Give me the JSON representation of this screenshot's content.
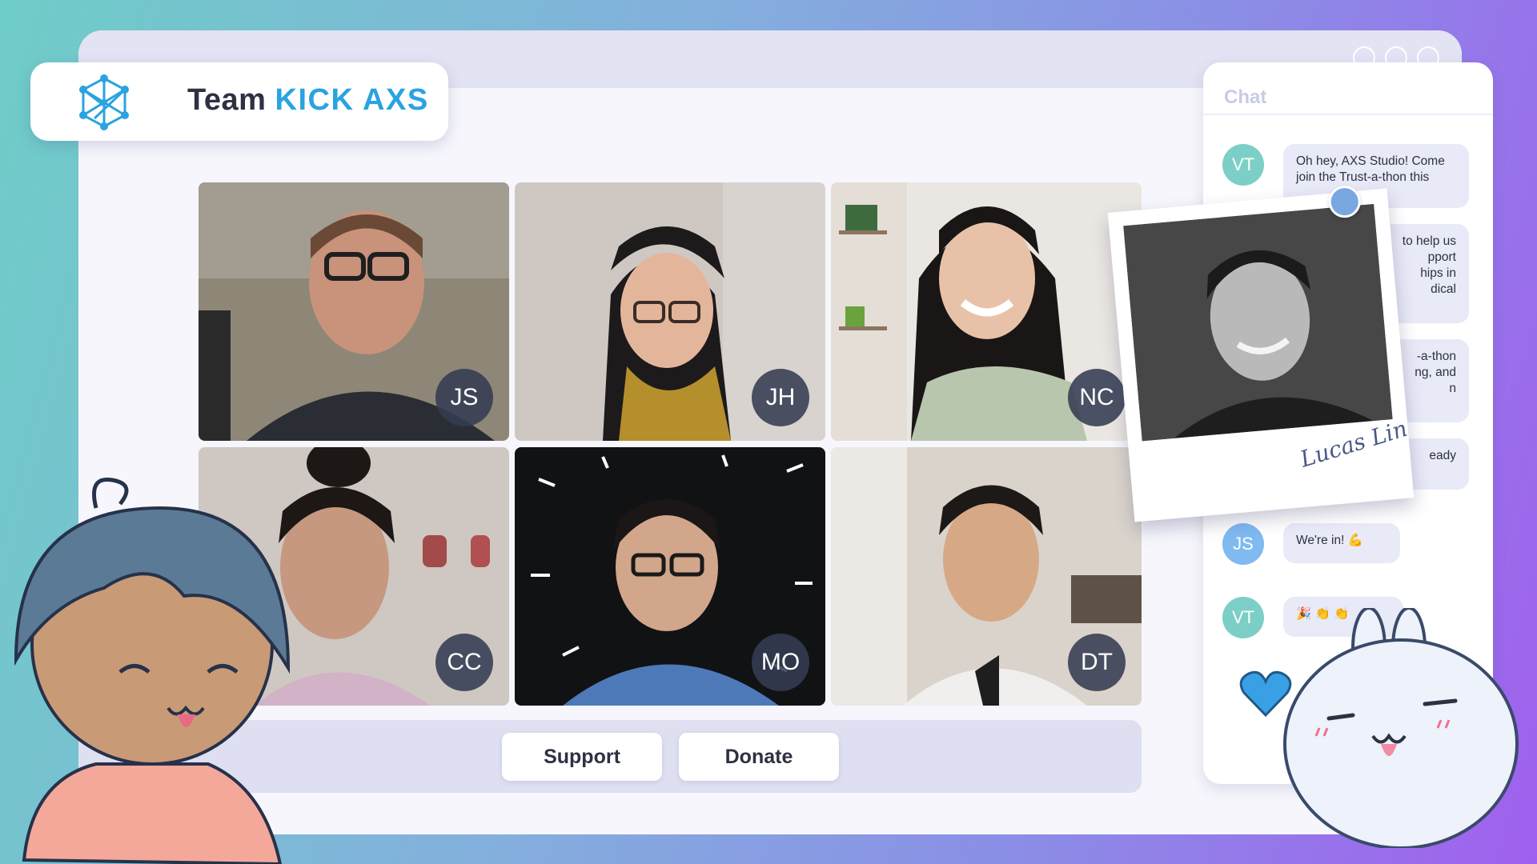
{
  "team": {
    "prefix": "Team",
    "name": "KICK AXS"
  },
  "participants": [
    {
      "initials": "JS",
      "bg": "#8e8778"
    },
    {
      "initials": "JH",
      "bg": "#cfc8c2"
    },
    {
      "initials": "NC",
      "bg": "#eae6e1"
    },
    {
      "initials": "CC",
      "bg": "#cfc7c2"
    },
    {
      "initials": "MO",
      "bg": "#111214"
    },
    {
      "initials": "DT",
      "bg": "#d9d3cb"
    }
  ],
  "controls": {
    "support_label": "Support",
    "donate_label": "Donate"
  },
  "chat": {
    "title": "Chat",
    "messages": [
      {
        "initials": "VT",
        "color": "#7ccfc6",
        "text": "Oh hey, AXS Studio! Come join the Trust-a-thon this"
      },
      {
        "initials": "",
        "color": "#7ccfc6",
        "text": "to help us\npport\nhips in\ndical"
      },
      {
        "initials": "",
        "color": "#7ccfc6",
        "text": "-a-thon\nng, and\nn"
      },
      {
        "initials": "",
        "color": "#7ccfc6",
        "text": "eady"
      },
      {
        "initials": "JS",
        "color": "#7fbaf0",
        "text": "We're in! 💪"
      },
      {
        "initials": "VT",
        "color": "#7ccfc6",
        "text": "🎉 👏 👏"
      }
    ]
  },
  "polaroid": {
    "signature": "Lucas Lin"
  },
  "colors": {
    "accent": "#2aa3e0",
    "window": "#f6f6fc",
    "bar": "#dedff0"
  }
}
